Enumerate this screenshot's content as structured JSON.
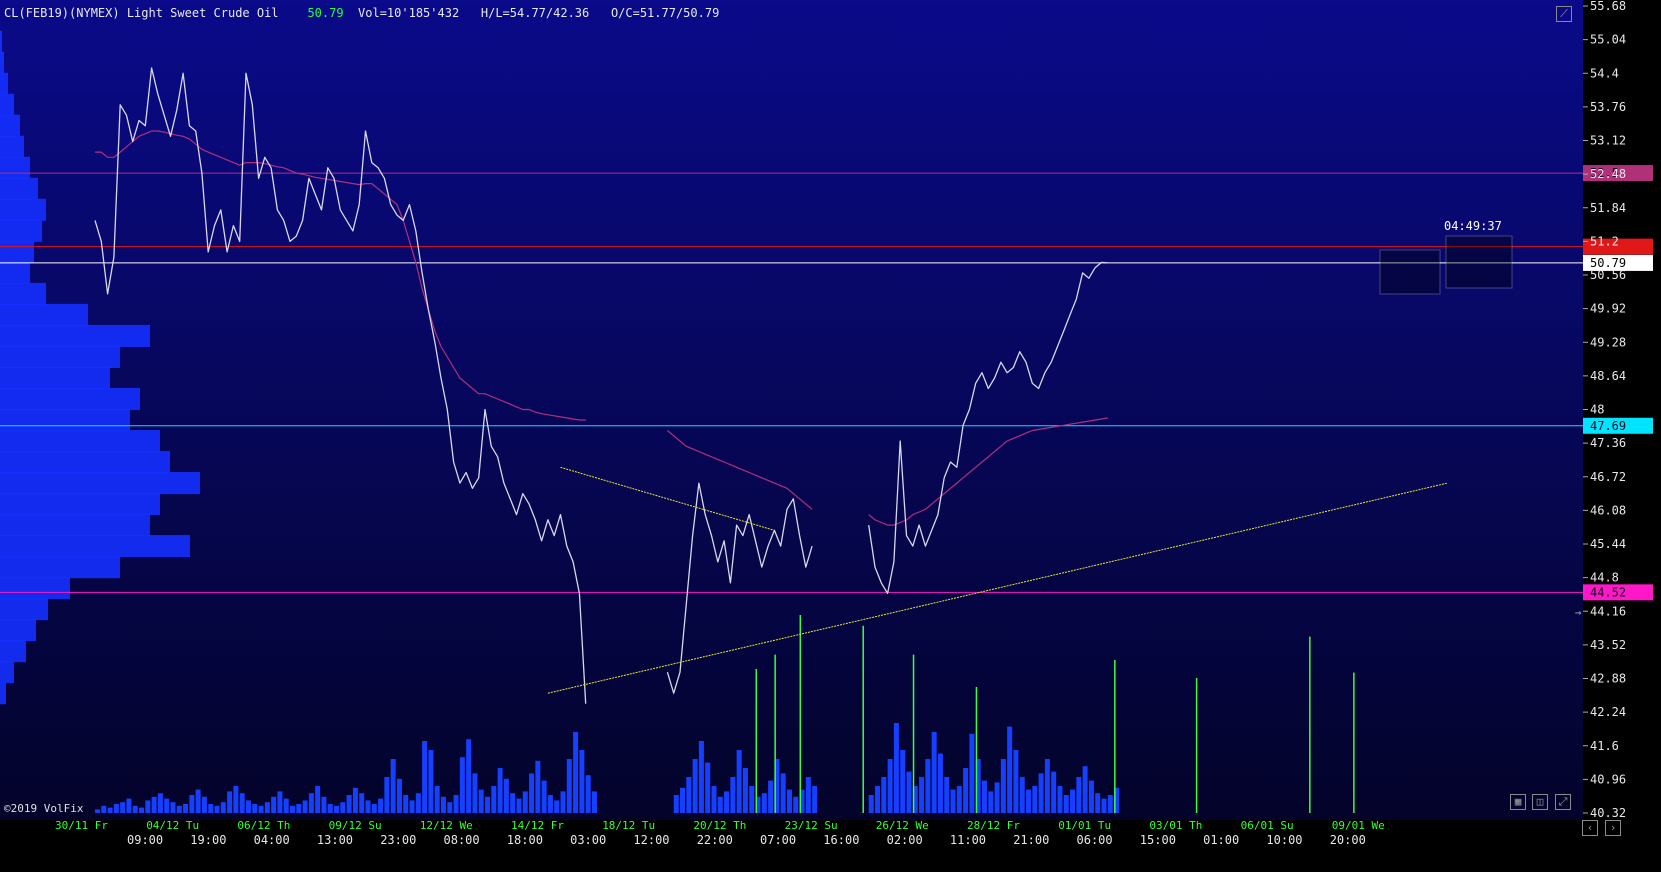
{
  "header": {
    "symbol": "CL(FEB19)(NYMEX) Light Sweet Crude Oil",
    "last": "50.79",
    "volume": "Vol=10'185'432",
    "high_low": "H/L=54.77/42.36",
    "open_close": "O/C=51.77/50.79"
  },
  "footer": {
    "copyright": "©2019 VolFix"
  },
  "timer": "04:49:37",
  "colors": {
    "bg_top": "#0a0a8a",
    "bg_bottom": "#03032a",
    "price": "#d8d8e8",
    "ma": "#b0307a",
    "profile": "#1530ff",
    "volume": "#1540ff",
    "vol_spike": "#3cff3c",
    "date_label": "#33ff33",
    "time_label": "#e8e8e8"
  },
  "chart_data": {
    "type": "line",
    "title": "CL(FEB19)(NYMEX) Light Sweet Crude Oil",
    "ylim": [
      40.32,
      55.68
    ],
    "y_ticks": [
      "55.68",
      "55.04",
      "54.4",
      "53.76",
      "53.12",
      "52.48",
      "51.84",
      "51.2",
      "50.56",
      "49.92",
      "49.28",
      "48.64",
      "48",
      "47.36",
      "46.72",
      "46.08",
      "45.44",
      "44.8",
      "44.16",
      "43.52",
      "42.88",
      "42.24",
      "41.6",
      "40.96",
      "40.32"
    ],
    "date_labels": [
      "30/11 Fr",
      "04/12 Tu",
      "06/12 Th",
      "09/12 Su",
      "12/12 We",
      "14/12 Fr",
      "18/12 Tu",
      "20/12 Th",
      "23/12 Su",
      "26/12 We",
      "28/12 Fr",
      "01/01 Tu",
      "03/01 Th",
      "06/01 Su",
      "09/01 We"
    ],
    "time_labels": [
      "09:00",
      "19:00",
      "04:00",
      "13:00",
      "23:00",
      "08:00",
      "18:00",
      "03:00",
      "12:00",
      "22:00",
      "07:00",
      "16:00",
      "02:00",
      "11:00",
      "21:00",
      "06:00",
      "15:00",
      "01:00",
      "10:00",
      "20:00"
    ],
    "x_index": [
      0,
      6,
      12,
      18,
      24,
      30,
      36,
      42,
      48,
      54,
      60,
      66,
      72,
      78,
      84,
      90,
      96,
      102,
      108,
      114,
      120,
      126,
      132,
      138,
      144,
      150,
      156,
      162,
      168,
      174,
      180,
      186,
      192,
      198,
      204,
      210,
      216,
      222,
      228,
      234,
      240,
      246,
      252,
      258,
      264,
      270,
      276,
      282,
      288,
      294,
      300,
      306,
      312,
      318,
      324,
      330,
      336,
      342,
      348,
      354,
      360,
      366,
      372,
      378,
      384,
      390,
      396,
      402,
      408,
      414,
      420,
      426,
      432,
      438,
      444,
      450,
      456,
      462,
      468,
      474,
      480,
      486,
      492,
      498,
      504,
      510,
      516,
      522,
      528,
      534,
      540,
      546,
      552,
      558,
      564,
      570,
      576,
      582,
      588,
      594,
      600,
      606,
      612,
      618,
      624,
      630,
      636,
      642,
      648,
      654,
      660,
      666,
      672,
      678,
      684,
      690,
      696,
      702,
      708,
      714,
      720,
      726,
      732,
      738,
      744,
      750,
      756,
      762,
      768,
      774,
      780,
      786,
      792,
      798,
      804,
      810,
      816,
      822,
      828,
      834,
      840,
      846,
      852,
      858,
      864,
      870,
      876,
      882,
      888,
      894,
      900,
      906,
      912,
      918,
      924,
      930,
      936,
      942,
      948,
      954,
      960,
      966,
      972,
      978,
      984,
      990,
      996,
      1002,
      1008,
      1014,
      1020,
      1026,
      1032,
      1038,
      1044,
      1050,
      1056,
      1062,
      1068,
      1074,
      1080,
      1086,
      1092,
      1098,
      1104,
      1110,
      1116,
      1122,
      1128,
      1134,
      1140,
      1146,
      1152,
      1158,
      1164,
      1170,
      1176,
      1182,
      1188,
      1194,
      1200,
      1206,
      1212,
      1218
    ],
    "price": [
      51.6,
      51.2,
      50.2,
      50.9,
      53.8,
      53.6,
      53.1,
      53.5,
      53.4,
      54.5,
      54.0,
      53.6,
      53.2,
      53.7,
      54.4,
      53.4,
      53.3,
      52.5,
      51.0,
      51.5,
      51.8,
      51.0,
      51.5,
      51.2,
      54.4,
      53.8,
      52.4,
      52.8,
      52.6,
      51.8,
      51.6,
      51.2,
      51.3,
      51.6,
      52.4,
      52.1,
      51.8,
      52.6,
      52.4,
      51.8,
      51.6,
      51.4,
      51.9,
      53.3,
      52.7,
      52.6,
      52.4,
      51.9,
      51.7,
      51.6,
      51.9,
      51.4,
      50.6,
      49.9,
      49.3,
      48.6,
      48.0,
      47.0,
      46.6,
      46.8,
      46.5,
      46.7,
      48.0,
      47.3,
      47.1,
      46.6,
      46.3,
      46.0,
      46.4,
      46.2,
      45.9,
      45.5,
      45.9,
      45.6,
      46.0,
      45.4,
      45.1,
      44.5,
      42.4,
      null,
      null,
      null,
      null,
      null,
      null,
      null,
      null,
      null,
      null,
      null,
      null,
      43.0,
      42.6,
      43.0,
      44.3,
      45.6,
      46.6,
      46.0,
      45.6,
      45.1,
      45.5,
      44.7,
      45.8,
      45.6,
      46.0,
      45.5,
      45.0,
      45.4,
      45.7,
      45.4,
      46.1,
      46.3,
      45.6,
      45.0,
      45.4,
      null,
      null,
      null,
      null,
      null,
      null,
      null,
      null,
      45.8,
      45.0,
      44.7,
      44.5,
      45.1,
      47.4,
      45.6,
      45.4,
      45.8,
      45.4,
      45.7,
      46.0,
      46.7,
      47.0,
      46.9,
      47.7,
      48.0,
      48.5,
      48.7,
      48.4,
      48.6,
      48.9,
      48.7,
      48.8,
      49.1,
      48.9,
      48.5,
      48.4,
      48.7,
      48.9,
      49.2,
      49.5,
      49.8,
      50.1,
      50.6,
      50.5,
      50.7,
      50.8,
      50.79,
      null,
      null,
      null,
      null,
      null,
      null,
      null,
      null,
      null,
      null,
      null,
      null,
      null,
      null,
      null,
      null,
      null,
      null,
      null,
      null,
      null,
      null,
      null,
      null,
      null,
      null,
      null,
      null,
      null,
      null,
      null,
      null,
      null,
      null
    ],
    "ma_series": {
      "name": "",
      "values": [
        52.9,
        52.9,
        52.8,
        52.8,
        52.9,
        53.0,
        53.1,
        53.2,
        53.25,
        53.3,
        53.3,
        53.28,
        53.25,
        53.22,
        53.2,
        53.15,
        53.05,
        52.95,
        52.9,
        52.85,
        52.8,
        52.75,
        52.7,
        52.65,
        52.7,
        52.7,
        52.7,
        52.68,
        52.65,
        52.62,
        52.6,
        52.55,
        52.5,
        52.48,
        52.45,
        52.42,
        52.4,
        52.38,
        52.36,
        52.34,
        52.32,
        52.3,
        52.28,
        52.3,
        52.3,
        52.2,
        52.1,
        52.0,
        51.9,
        51.6,
        51.2,
        50.8,
        50.3,
        49.9,
        49.5,
        49.2,
        49.0,
        48.8,
        48.6,
        48.5,
        48.4,
        48.3,
        48.3,
        48.25,
        48.2,
        48.15,
        48.1,
        48.05,
        48.0,
        48.0,
        47.95,
        47.92,
        47.9,
        47.88,
        47.86,
        47.84,
        47.82,
        47.8,
        47.8,
        null,
        null,
        null,
        null,
        null,
        null,
        null,
        null,
        null,
        null,
        null,
        null,
        47.6,
        47.5,
        47.4,
        47.3,
        47.25,
        47.2,
        47.15,
        47.1,
        47.05,
        47.0,
        46.95,
        46.9,
        46.85,
        46.8,
        46.75,
        46.7,
        46.65,
        46.6,
        46.55,
        46.5,
        46.4,
        46.3,
        46.2,
        46.1,
        null,
        null,
        null,
        null,
        null,
        null,
        null,
        null,
        46.0,
        45.9,
        45.85,
        45.8,
        45.8,
        45.85,
        45.9,
        46.0,
        46.05,
        46.1,
        46.2,
        46.3,
        46.4,
        46.5,
        46.6,
        46.7,
        46.8,
        46.9,
        47.0,
        47.1,
        47.2,
        47.3,
        47.4,
        47.45,
        47.5,
        47.55,
        47.6,
        47.62,
        47.64,
        47.66,
        47.68,
        47.7,
        47.72,
        47.74,
        47.76,
        47.78,
        47.8,
        47.82,
        47.84,
        null,
        null,
        null,
        null,
        null,
        null,
        null,
        null,
        null,
        null,
        null,
        null,
        null,
        null,
        null,
        null,
        null,
        null,
        null,
        null,
        null,
        null,
        null,
        null,
        null,
        null,
        null,
        null,
        null,
        null,
        null,
        null,
        null,
        null
      ]
    },
    "horizontal_levels": [
      {
        "value": 52.5,
        "label": "52.5",
        "color": "#b0307a"
      },
      {
        "value": 51.1,
        "label": "",
        "color": "#e01818"
      },
      {
        "value": 50.79,
        "label": "50.79",
        "color": "#ffffff"
      },
      {
        "value": 47.69,
        "label": "47.69",
        "color": "#00e5ff"
      },
      {
        "value": 44.52,
        "label": "44.52",
        "color": "#ff18c8"
      }
    ],
    "trendlines": [
      {
        "from": [
          74,
          46.9
        ],
        "to": [
          108,
          45.7
        ],
        "color": "#e8e830"
      },
      {
        "from": [
          72,
          42.6
        ],
        "to": [
          215,
          46.6
        ],
        "color": "#e8e830"
      }
    ],
    "volume_profile": [
      {
        "price": 55.0,
        "vol": 2
      },
      {
        "price": 54.6,
        "vol": 4
      },
      {
        "price": 54.2,
        "vol": 8
      },
      {
        "price": 53.8,
        "vol": 14
      },
      {
        "price": 53.4,
        "vol": 20
      },
      {
        "price": 53.0,
        "vol": 24
      },
      {
        "price": 52.6,
        "vol": 30
      },
      {
        "price": 52.2,
        "vol": 38
      },
      {
        "price": 51.8,
        "vol": 46
      },
      {
        "price": 51.4,
        "vol": 42
      },
      {
        "price": 51.0,
        "vol": 34
      },
      {
        "price": 50.6,
        "vol": 30
      },
      {
        "price": 50.2,
        "vol": 46
      },
      {
        "price": 49.8,
        "vol": 88
      },
      {
        "price": 49.4,
        "vol": 150
      },
      {
        "price": 49.0,
        "vol": 120
      },
      {
        "price": 48.6,
        "vol": 110
      },
      {
        "price": 48.2,
        "vol": 140
      },
      {
        "price": 47.8,
        "vol": 130
      },
      {
        "price": 47.4,
        "vol": 160
      },
      {
        "price": 47.0,
        "vol": 170
      },
      {
        "price": 46.6,
        "vol": 200
      },
      {
        "price": 46.2,
        "vol": 160
      },
      {
        "price": 45.8,
        "vol": 150
      },
      {
        "price": 45.4,
        "vol": 190
      },
      {
        "price": 45.0,
        "vol": 120
      },
      {
        "price": 44.6,
        "vol": 70
      },
      {
        "price": 44.2,
        "vol": 48
      },
      {
        "price": 43.8,
        "vol": 36
      },
      {
        "price": 43.4,
        "vol": 26
      },
      {
        "price": 43.0,
        "vol": 14
      },
      {
        "price": 42.6,
        "vol": 6
      }
    ],
    "volume": [
      4,
      8,
      6,
      10,
      12,
      16,
      8,
      6,
      14,
      18,
      22,
      16,
      12,
      8,
      10,
      20,
      26,
      18,
      10,
      8,
      12,
      24,
      30,
      22,
      14,
      10,
      8,
      12,
      18,
      24,
      16,
      8,
      10,
      14,
      22,
      30,
      18,
      10,
      8,
      12,
      20,
      28,
      22,
      14,
      10,
      16,
      40,
      60,
      38,
      20,
      14,
      22,
      80,
      70,
      30,
      18,
      12,
      20,
      62,
      82,
      44,
      26,
      18,
      30,
      50,
      38,
      22,
      16,
      24,
      44,
      58,
      36,
      20,
      14,
      24,
      60,
      90,
      70,
      42,
      24,
      null,
      null,
      null,
      null,
      null,
      null,
      null,
      null,
      null,
      null,
      null,
      null,
      20,
      28,
      40,
      60,
      80,
      56,
      30,
      18,
      24,
      40,
      70,
      50,
      30,
      18,
      22,
      36,
      60,
      44,
      26,
      18,
      26,
      40,
      30,
      null,
      null,
      null,
      null,
      null,
      null,
      null,
      null,
      20,
      30,
      40,
      60,
      100,
      70,
      46,
      30,
      40,
      60,
      90,
      66,
      40,
      26,
      30,
      50,
      88,
      60,
      36,
      24,
      34,
      60,
      96,
      70,
      40,
      26,
      30,
      44,
      60,
      46,
      30,
      20,
      26,
      40,
      52,
      36,
      22,
      16,
      20,
      28,
      null,
      null,
      null,
      null,
      null,
      null,
      null,
      null,
      null,
      null,
      null,
      null,
      null,
      null,
      null,
      null,
      null,
      null,
      null,
      null,
      null,
      null,
      null,
      null,
      null,
      null,
      null,
      null,
      null,
      null,
      null,
      null,
      null,
      null
    ],
    "volume_spikes": [
      {
        "x": 105,
        "vol": 80
      },
      {
        "x": 108,
        "vol": 88
      },
      {
        "x": 112,
        "vol": 110
      },
      {
        "x": 122,
        "vol": 104
      },
      {
        "x": 130,
        "vol": 88
      },
      {
        "x": 140,
        "vol": 70
      },
      {
        "x": 162,
        "vol": 85
      },
      {
        "x": 175,
        "vol": 75
      },
      {
        "x": 193,
        "vol": 98
      },
      {
        "x": 200,
        "vol": 78
      }
    ]
  }
}
